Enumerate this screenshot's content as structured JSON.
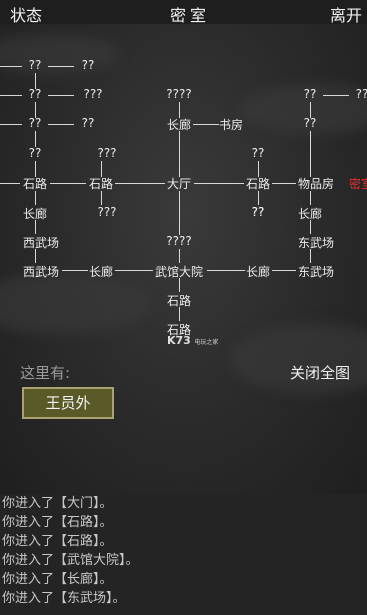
{
  "topbar": {
    "status": "状态",
    "title": "密室",
    "leave": "离开"
  },
  "map": {
    "nodes": [
      "??",
      "??",
      "??",
      "???",
      "??",
      "??",
      "????",
      "??",
      "??",
      "??",
      "长廊",
      "书房",
      "??",
      "??",
      "???",
      "??",
      "石路",
      "石路",
      "大厅",
      "石路",
      "物品房",
      "密室",
      "长廊",
      "???",
      "??",
      "长廊",
      "西武场",
      "????",
      "东武场",
      "西武场",
      "长廊",
      "武馆大院",
      "长廊",
      "东武场",
      "石路",
      "石路"
    ]
  },
  "watermark": {
    "brand": "K73",
    "sub": "电玩之家"
  },
  "here_label": "这里有:",
  "close_map": "关闭全图",
  "npc": "王员外",
  "log": [
    "你进入了【大门】。",
    "你进入了【石路】。",
    "你进入了【石路】。",
    "你进入了【武馆大院】。",
    "你进入了【长廊】。",
    "你进入了【东武场】。"
  ]
}
